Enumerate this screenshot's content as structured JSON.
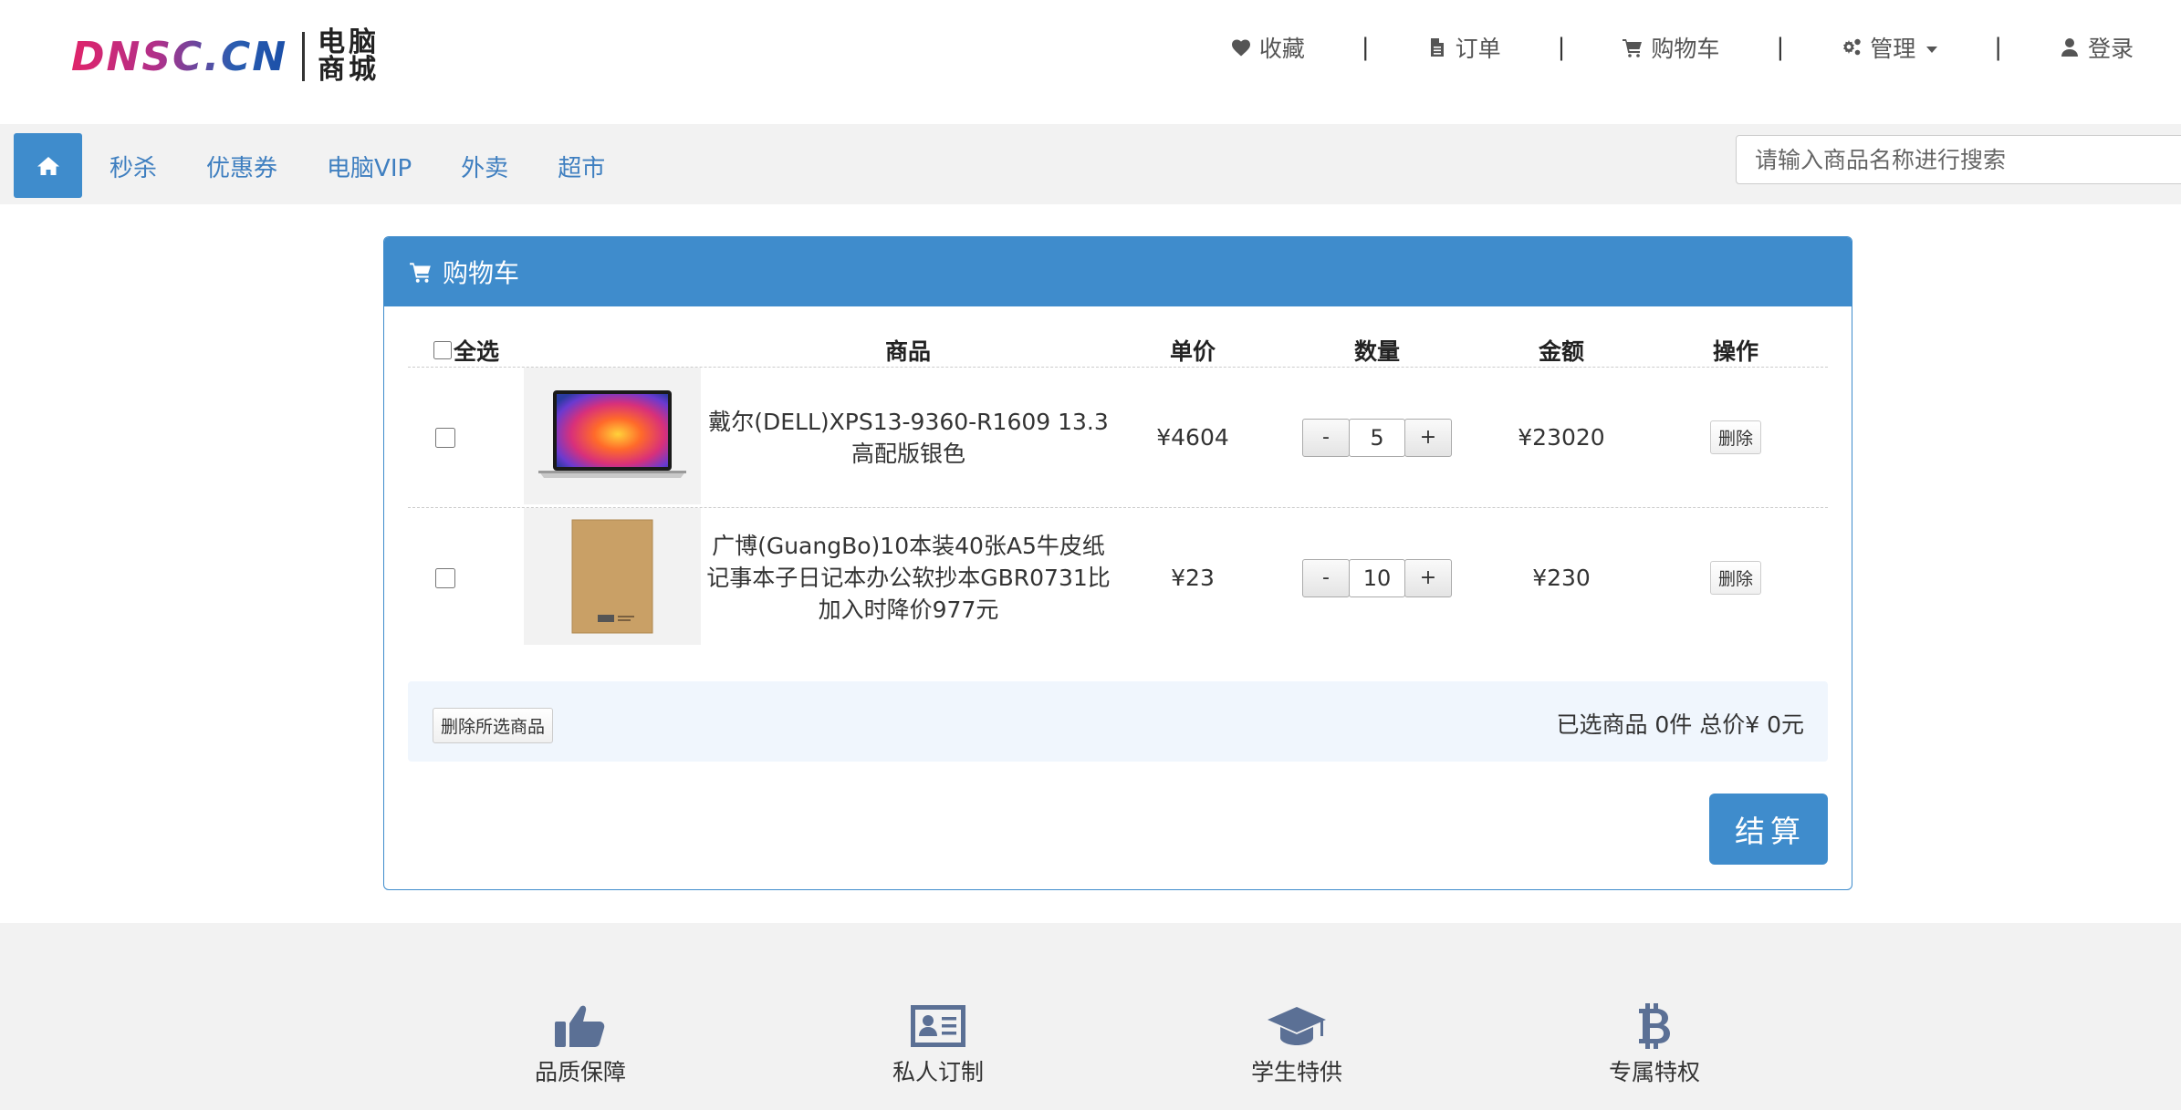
{
  "header": {
    "logo_text": "DNSC.CN",
    "logo_cn_line1": "电脑",
    "logo_cn_line2": "商城",
    "separator": "|",
    "nav": {
      "favorites": "收藏",
      "orders": "订单",
      "cart": "购物车",
      "admin": "管理",
      "login": "登录"
    }
  },
  "navbar": {
    "links": [
      "秒杀",
      "优惠券",
      "电脑VIP",
      "外卖",
      "超市"
    ],
    "search_placeholder": "请输入商品名称进行搜索"
  },
  "cart": {
    "title": "购物车",
    "columns": {
      "select_all": "全选",
      "product": "商品",
      "unit_price": "单价",
      "quantity": "数量",
      "amount": "金额",
      "action": "操作"
    },
    "items": [
      {
        "name": "戴尔(DELL)XPS13-9360-R1609 13.3高配版银色",
        "price": "¥4604",
        "quantity": "5",
        "amount": "¥23020",
        "delete_label": "删除",
        "image_icon": "laptop-image"
      },
      {
        "name": "广博(GuangBo)10本装40张A5牛皮纸记事本子日记本办公软抄本GBR0731比加入时降价977元",
        "price": "¥23",
        "quantity": "10",
        "amount": "¥230",
        "delete_label": "删除",
        "image_icon": "notebook-image"
      }
    ],
    "minus_label": "-",
    "plus_label": "+",
    "delete_selected": "删除所选商品",
    "summary": "已选商品 0件 总价¥ 0元",
    "checkout": "结算"
  },
  "footer": {
    "features": [
      {
        "label": "品质保障",
        "icon": "thumbs-up-icon"
      },
      {
        "label": "私人订制",
        "icon": "id-card-icon"
      },
      {
        "label": "学生特供",
        "icon": "graduation-cap-icon"
      },
      {
        "label": "专属特权",
        "icon": "bitcoin-icon"
      }
    ]
  },
  "colors": {
    "primary": "#3f8ccc",
    "link": "#3f7fc0",
    "navbar_bg": "#f2f2f2",
    "summary_bg": "#f0f6fd",
    "footer_icon": "#5b7095"
  }
}
